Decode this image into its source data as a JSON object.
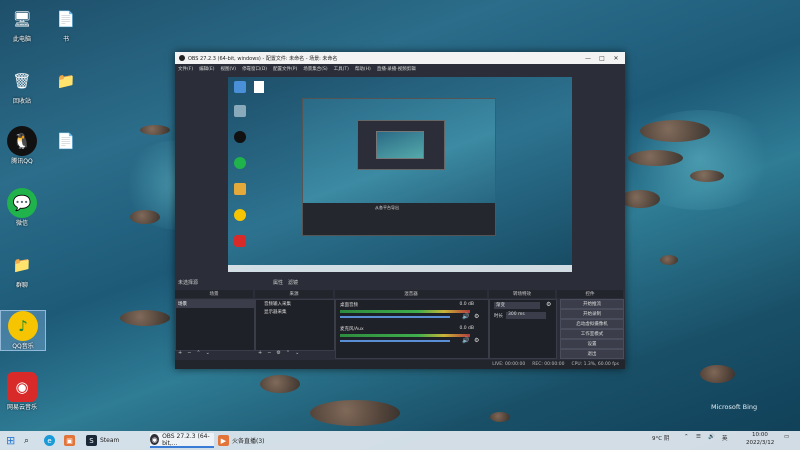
{
  "desktop_icons": [
    {
      "name": "此电脑",
      "glyph": "🖥",
      "color": "#4a90d9"
    },
    {
      "name": "回收站",
      "glyph": "🗑",
      "color": "#7fa7c9"
    },
    {
      "name": "腾讯QQ",
      "glyph": "🐧",
      "color": "#111"
    },
    {
      "name": "微信",
      "glyph": "💬",
      "color": "#20b24b"
    },
    {
      "name": "群聊",
      "glyph": "📁",
      "color": "#e3a93b"
    },
    {
      "name": "QQ音乐",
      "glyph": "♪",
      "color": "#f6c400"
    },
    {
      "name": "网易云音乐",
      "glyph": "◉",
      "color": "#d92a2a"
    },
    {
      "name": "书",
      "glyph": "📄",
      "color": "#d9463a"
    },
    {
      "name": "",
      "glyph": "📁",
      "color": "#e3b04b"
    },
    {
      "name": "",
      "glyph": "📄",
      "color": "#e6e6e6"
    }
  ],
  "obs": {
    "title": "OBS 27.2.3 (64-bit, windows) - 配置文件: 未命名 - 场景: 未命名",
    "menu": [
      "文件(F)",
      "编辑(E)",
      "视图(V)",
      "停靠窗口(D)",
      "配置文件(P)",
      "场景集合(S)",
      "工具(T)",
      "帮助(H)",
      "直播·录播·视频剪辑"
    ],
    "docks": {
      "scenes_header": "场景",
      "sources_header": "来源",
      "mixer_header": "混音器",
      "transitions_header": "转场特效",
      "controls_header": "控件",
      "scene_item": "场景",
      "sources": [
        "显示器采集",
        "音频输入采集"
      ],
      "toolbar_left": "未选择源",
      "toolbar_props": "属性",
      "toolbar_filters": "滤镜",
      "mixer": [
        {
          "name": "桌面音频",
          "db": "0.0 dB"
        },
        {
          "name": "麦克风/Aux",
          "db": "0.0 dB"
        }
      ],
      "transition_name": "渐变",
      "duration_label": "时长",
      "duration_value": "300 ms"
    },
    "controls": [
      "开始推流",
      "开始录制",
      "启动虚拟摄像机",
      "工作室模式",
      "设置",
      "退出"
    ],
    "status": [
      "LIVE: 00:00:00",
      "REC: 00:00:00",
      "CPU: 1.3%, 60.00 fps"
    ],
    "preview_caption": "从各平台导出"
  },
  "taskbar": {
    "items": [
      {
        "label": "Steam",
        "color": "#1b2838",
        "glyph": "S"
      },
      {
        "label": "OBS 27.2.3 (64-bit,...",
        "color": "#302f38",
        "glyph": "◉"
      },
      {
        "label": "火各直播(3)",
        "color": "#e2743a",
        "glyph": "▶"
      }
    ],
    "weather": "9°C 阴",
    "time": "10:00",
    "date": "2022/3/12"
  },
  "bing": "Microsoft Bing"
}
